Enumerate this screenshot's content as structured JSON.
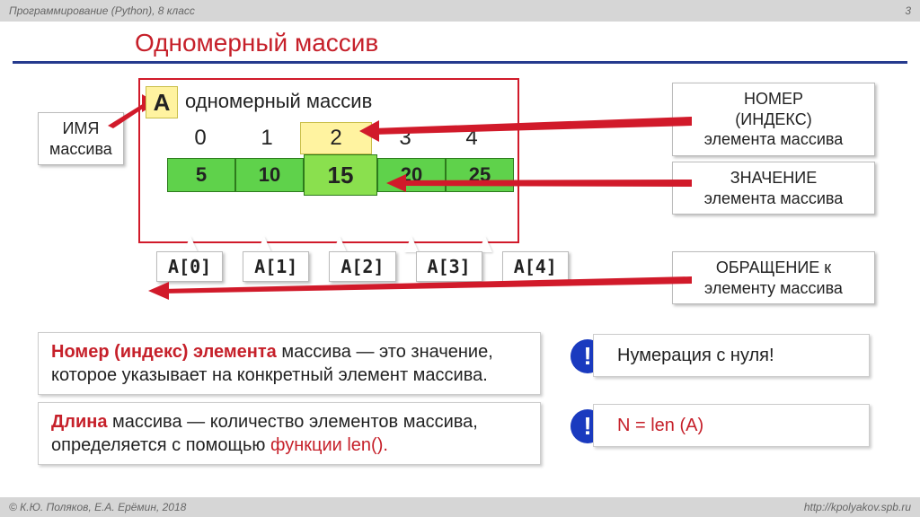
{
  "header": {
    "left": "Программирование (Python), 8 класс",
    "page": "3"
  },
  "title": "Одномерный массив",
  "name_label": "ИМЯ\nмассива",
  "array_letter": "A",
  "subtitle": "одномерный массив",
  "indices": [
    "0",
    "1",
    "2",
    "3",
    "4"
  ],
  "values": [
    "5",
    "10",
    "15",
    "20",
    "25"
  ],
  "highlight": 2,
  "access": [
    "A[0]",
    "A[1]",
    "A[2]",
    "A[3]",
    "A[4]"
  ],
  "callouts": {
    "index": "НОМЕР\n(ИНДЕКС)\nэлемента массива",
    "value": "ЗНАЧЕНИЕ\nэлемента массива",
    "ref": "ОБРАЩЕНИЕ к\nэлементу массива"
  },
  "defs": {
    "idx_bold": "Номер (индекс) элемента",
    "idx_rest": " массива — это значение,\nкоторое указывает на конкретный элемент массива.",
    "len_bold": "Длина",
    "len_mid": " массива — количество элементов массива,\nопределяется с помощью ",
    "len_func": "функции  len().",
    "zero": "Нумерация с нуля!",
    "formula": "N = len (A)"
  },
  "footer": {
    "left": "© К.Ю. Поляков, Е.А. Ерёмин, 2018",
    "right": "http://kpolyakov.spb.ru"
  }
}
